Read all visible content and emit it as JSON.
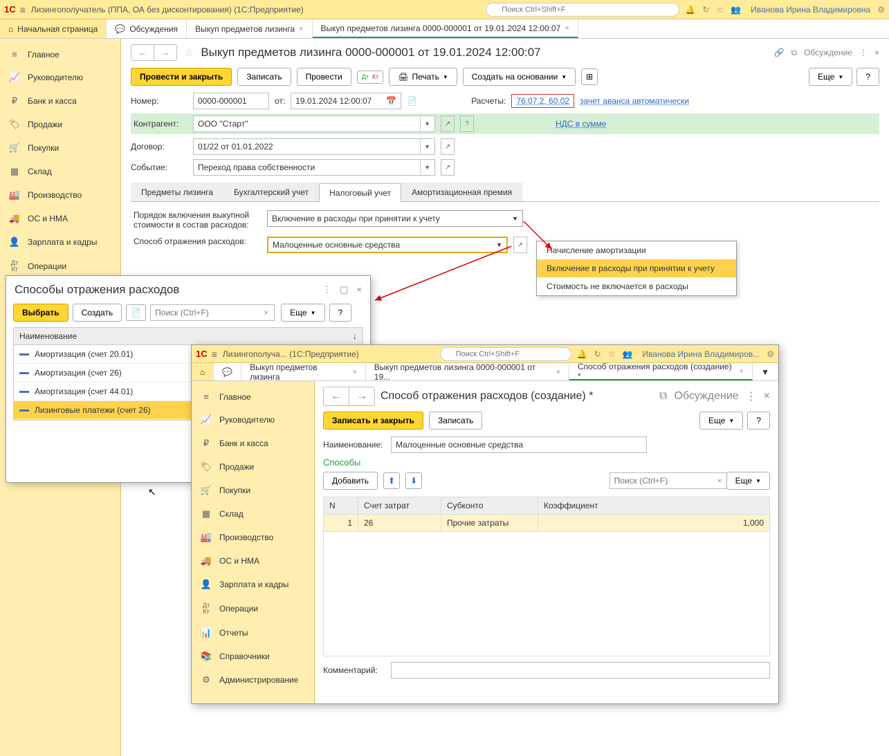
{
  "header": {
    "logo": "1C",
    "app_title": "Лизингополучатель (ППА, ОА без дисконтирования)  (1С:Предприятие)",
    "search_placeholder": "Поиск Ctrl+Shift+F",
    "user": "Иванова Ирина Владимировна"
  },
  "tabs": {
    "home": "Начальная страница",
    "discuss": "Обсуждения",
    "t1": "Выкуп предметов лизинга",
    "t2": "Выкуп предметов лизинга 0000-000001 от 19.01.2024 12:00:07"
  },
  "sidebar": {
    "items": [
      "Главное",
      "Руководителю",
      "Банк и касса",
      "Продажи",
      "Покупки",
      "Склад",
      "Производство",
      "ОС и НМА",
      "Зарплата и кадры",
      "Операции"
    ]
  },
  "doc": {
    "title": "Выкуп предметов лизинга 0000-000001 от 19.01.2024 12:00:07",
    "discuss": "Обсуждение",
    "btn_post_close": "Провести и закрыть",
    "btn_save": "Записать",
    "btn_post": "Провести",
    "btn_print": "Печать",
    "btn_create_on": "Создать на основании",
    "btn_more": "Еще",
    "lbl_number": "Номер:",
    "number": "0000-000001",
    "lbl_ot": "от:",
    "date": "19.01.2024 12:00:07",
    "lbl_calc": "Расчеты:",
    "calc_link": "76.07.2, 60.02",
    "calc_text": "зачет аванса автоматически",
    "lbl_contr": "Контрагент:",
    "contr": "ООО \"Старт\"",
    "vat": "НДС в сумме",
    "lbl_dog": "Договор:",
    "dog": "01/22 от 01.01.2022",
    "lbl_event": "Событие:",
    "event": "Переход права собственности",
    "tabs2": [
      "Предметы лизинга",
      "Бухгалтерский учет",
      "Налоговый учет",
      "Амортизационная премия"
    ],
    "lbl_order": "Порядок включения выкупной стоимости в состав расходов:",
    "order_val": "Включение в расходы при принятии к учету",
    "lbl_method": "Способ отражения расходов:",
    "method_val": "Малоценные основные средства",
    "dropdown": [
      "Начисление амортизации",
      "Включение в расходы при принятии к учету",
      "Стоимость не включается в расходы"
    ]
  },
  "popup1": {
    "title": "Способы отражения расходов",
    "btn_select": "Выбрать",
    "btn_create": "Создать",
    "search_ph": "Поиск (Ctrl+F)",
    "btn_more": "Еще",
    "col": "Наименование",
    "rows": [
      "Амортизация (счет 20.01)",
      "Амортизация (счет 26)",
      "Амортизация (счет 44.01)",
      "Лизинговые платежи (счет 26)"
    ]
  },
  "win2": {
    "header_title": "Лизингополуча...  (1С:Предприятие)",
    "search_ph": "Поиск Ctrl+Shift+F",
    "user": "Иванова Ирина Владимиров...",
    "tabs": [
      "Выкуп предметов лизинга",
      "Выкуп предметов лизинга 0000-000001 от 19...",
      "Способ отражения расходов (создание) *"
    ],
    "sidebar": [
      "Главное",
      "Руководителю",
      "Банк и касса",
      "Продажи",
      "Покупки",
      "Склад",
      "Производство",
      "ОС и НМА",
      "Зарплата и кадры",
      "Операции",
      "Отчеты",
      "Справочники",
      "Администрирование"
    ],
    "title": "Способ отражения расходов (создание) *",
    "discuss": "Обсуждение",
    "btn_save_close": "Записать и закрыть",
    "btn_save": "Записать",
    "btn_more": "Еще",
    "lbl_name": "Наименование:",
    "name_val": "Малоценные основные средства",
    "section": "Способы",
    "btn_add": "Добавить",
    "search_ph2": "Поиск (Ctrl+F)",
    "cols": [
      "N",
      "Счет затрат",
      "Субконто",
      "Коэффициент"
    ],
    "row": {
      "n": "1",
      "acc": "26",
      "sub": "Прочие затраты",
      "coef": "1,000"
    },
    "lbl_comment": "Комментарий:"
  }
}
